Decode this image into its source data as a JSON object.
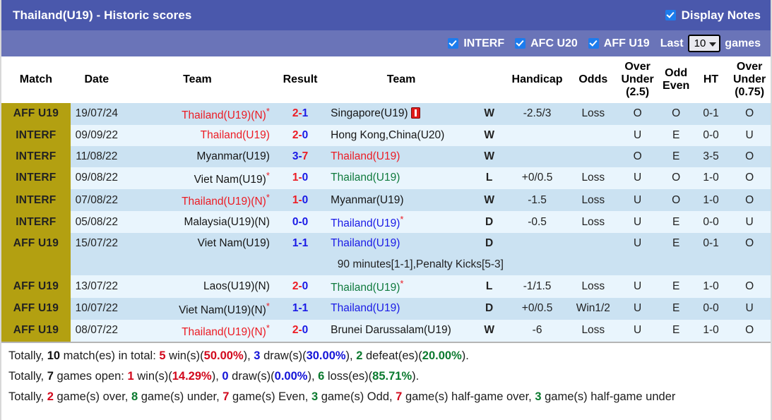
{
  "header": {
    "title": "Thailand(U19) - Historic scores",
    "display_notes_label": "Display Notes",
    "display_notes_checked": true
  },
  "filters": {
    "items": [
      {
        "label": "INTERF",
        "checked": true
      },
      {
        "label": "AFC U20",
        "checked": true
      },
      {
        "label": "AFF U19",
        "checked": true
      }
    ],
    "last_label": "Last",
    "games_count": "10",
    "games_label": "games"
  },
  "table": {
    "columns": [
      "Match",
      "Date",
      "Team",
      "Result",
      "Team",
      "",
      "Handicap",
      "Odds",
      "Over Under (2.5)",
      "Odd Even",
      "HT",
      "Over Under (0.75)"
    ],
    "columns_multiline": {
      "over_under_25": [
        "Over",
        "Under",
        "(2.5)"
      ],
      "odd_even": [
        "Odd",
        "Even"
      ],
      "over_under_075": [
        "Over",
        "Under",
        "(0.75)"
      ]
    },
    "rows": [
      {
        "league": "AFF U19",
        "date": "19/07/24",
        "home": "Thailand(U19)(N)",
        "home_color": "red",
        "home_star": true,
        "score_left": "2",
        "score_right": "1",
        "score_left_color": "red",
        "score_right_color": "blue",
        "away": "Singapore(U19)",
        "away_color": "black",
        "away_star": false,
        "away_redcard": true,
        "wld": "W",
        "wld_color": "red",
        "handicap": "-2.5/3",
        "odds": "Loss",
        "odds_color": "green",
        "ou": "O",
        "ou_color": "red",
        "oe": "O",
        "oe_color": "green",
        "ht": "0-1",
        "ou2": "O",
        "ou2_color": "red",
        "note": null
      },
      {
        "league": "INTERF",
        "date": "09/09/22",
        "home": "Thailand(U19)",
        "home_color": "red",
        "home_star": false,
        "score_left": "2",
        "score_right": "0",
        "score_left_color": "red",
        "score_right_color": "blue",
        "away": "Hong Kong,China(U20)",
        "away_color": "black",
        "away_star": false,
        "away_redcard": false,
        "wld": "W",
        "wld_color": "red",
        "handicap": "",
        "odds": "",
        "odds_color": "green",
        "ou": "U",
        "ou_color": "green",
        "oe": "E",
        "oe_color": "red",
        "ht": "0-0",
        "ou2": "U",
        "ou2_color": "green",
        "note": null
      },
      {
        "league": "INTERF",
        "date": "11/08/22",
        "home": "Myanmar(U19)",
        "home_color": "black",
        "home_star": false,
        "score_left": "3",
        "score_right": "7",
        "score_left_color": "blue",
        "score_right_color": "red",
        "away": "Thailand(U19)",
        "away_color": "red",
        "away_star": false,
        "away_redcard": false,
        "wld": "W",
        "wld_color": "red",
        "handicap": "",
        "odds": "",
        "odds_color": "green",
        "ou": "O",
        "ou_color": "red",
        "oe": "E",
        "oe_color": "red",
        "ht": "3-5",
        "ou2": "O",
        "ou2_color": "red",
        "note": null
      },
      {
        "league": "INTERF",
        "date": "09/08/22",
        "home": "Viet Nam(U19)",
        "home_color": "black",
        "home_star": true,
        "score_left": "1",
        "score_right": "0",
        "score_left_color": "red",
        "score_right_color": "blue",
        "away": "Thailand(U19)",
        "away_color": "green",
        "away_star": false,
        "away_redcard": false,
        "wld": "L",
        "wld_color": "green",
        "handicap": "+0/0.5",
        "odds": "Loss",
        "odds_color": "green",
        "ou": "U",
        "ou_color": "green",
        "oe": "O",
        "oe_color": "green",
        "ht": "1-0",
        "ou2": "O",
        "ou2_color": "red",
        "note": null
      },
      {
        "league": "INTERF",
        "date": "07/08/22",
        "home": "Thailand(U19)(N)",
        "home_color": "red",
        "home_star": true,
        "score_left": "1",
        "score_right": "0",
        "score_left_color": "red",
        "score_right_color": "blue",
        "away": "Myanmar(U19)",
        "away_color": "black",
        "away_star": false,
        "away_redcard": false,
        "wld": "W",
        "wld_color": "red",
        "handicap": "-1.5",
        "odds": "Loss",
        "odds_color": "green",
        "ou": "U",
        "ou_color": "green",
        "oe": "O",
        "oe_color": "green",
        "ht": "1-0",
        "ou2": "O",
        "ou2_color": "red",
        "note": null
      },
      {
        "league": "INTERF",
        "date": "05/08/22",
        "home": "Malaysia(U19)(N)",
        "home_color": "black",
        "home_star": false,
        "score_left": "0",
        "score_right": "0",
        "score_left_color": "blue",
        "score_right_color": "blue",
        "away": "Thailand(U19)",
        "away_color": "blue",
        "away_star": true,
        "away_redcard": false,
        "wld": "D",
        "wld_color": "blue",
        "handicap": "-0.5",
        "odds": "Loss",
        "odds_color": "green",
        "ou": "U",
        "ou_color": "green",
        "oe": "E",
        "oe_color": "red",
        "ht": "0-0",
        "ou2": "U",
        "ou2_color": "green",
        "note": null
      },
      {
        "league": "AFF U19",
        "date": "15/07/22",
        "home": "Viet Nam(U19)",
        "home_color": "black",
        "home_star": false,
        "score_left": "1",
        "score_right": "1",
        "score_left_color": "blue",
        "score_right_color": "blue",
        "away": "Thailand(U19)",
        "away_color": "blue",
        "away_star": false,
        "away_redcard": false,
        "wld": "D",
        "wld_color": "blue",
        "handicap": "",
        "odds": "",
        "odds_color": "green",
        "ou": "U",
        "ou_color": "green",
        "oe": "E",
        "oe_color": "red",
        "ht": "0-1",
        "ou2": "O",
        "ou2_color": "red",
        "note": "90 minutes[1-1],Penalty Kicks[5-3]"
      },
      {
        "league": "AFF U19",
        "date": "13/07/22",
        "home": "Laos(U19)(N)",
        "home_color": "black",
        "home_star": false,
        "score_left": "2",
        "score_right": "0",
        "score_left_color": "red",
        "score_right_color": "blue",
        "away": "Thailand(U19)",
        "away_color": "green",
        "away_star": true,
        "away_redcard": false,
        "wld": "L",
        "wld_color": "green",
        "handicap": "-1/1.5",
        "odds": "Loss",
        "odds_color": "green",
        "ou": "U",
        "ou_color": "green",
        "oe": "E",
        "oe_color": "red",
        "ht": "1-0",
        "ou2": "O",
        "ou2_color": "red",
        "note": null
      },
      {
        "league": "AFF U19",
        "date": "10/07/22",
        "home": "Viet Nam(U19)(N)",
        "home_color": "black",
        "home_star": true,
        "score_left": "1",
        "score_right": "1",
        "score_left_color": "blue",
        "score_right_color": "blue",
        "away": "Thailand(U19)",
        "away_color": "blue",
        "away_star": false,
        "away_redcard": false,
        "wld": "D",
        "wld_color": "blue",
        "handicap": "+0/0.5",
        "odds": "Win1/2",
        "odds_color": "red",
        "ou": "U",
        "ou_color": "green",
        "oe": "E",
        "oe_color": "red",
        "ht": "0-0",
        "ou2": "U",
        "ou2_color": "green",
        "note": null
      },
      {
        "league": "AFF U19",
        "date": "08/07/22",
        "home": "Thailand(U19)(N)",
        "home_color": "red",
        "home_star": true,
        "score_left": "2",
        "score_right": "0",
        "score_left_color": "red",
        "score_right_color": "blue",
        "away": "Brunei Darussalam(U19)",
        "away_color": "black",
        "away_star": false,
        "away_redcard": false,
        "wld": "W",
        "wld_color": "red",
        "handicap": "-6",
        "odds": "Loss",
        "odds_color": "green",
        "ou": "U",
        "ou_color": "green",
        "oe": "E",
        "oe_color": "red",
        "ht": "1-0",
        "ou2": "O",
        "ou2_color": "red",
        "note": null
      }
    ]
  },
  "summary": {
    "line1": {
      "prefix": "Totally, ",
      "total": "10",
      "mid1": " match(es) in total: ",
      "wins": "5",
      "wins_label": " win(s)(",
      "wins_pct": "50.00%",
      "close1": "), ",
      "draws": "3",
      "draws_label": " draw(s)(",
      "draws_pct": "30.00%",
      "close2": "), ",
      "defeats": "2",
      "defeats_label": " defeat(es)(",
      "defeats_pct": "20.00%",
      "close3": ")."
    },
    "line2": {
      "prefix": "Totally, ",
      "open": "7",
      "mid1": " games open: ",
      "wins": "1",
      "wins_label": " win(s)(",
      "wins_pct": "14.29%",
      "close1": "), ",
      "draws": "0",
      "draws_label": " draw(s)(",
      "draws_pct": "0.00%",
      "close2": "), ",
      "losses": "6",
      "losses_label": " loss(es)(",
      "losses_pct": "85.71%",
      "close3": ")."
    },
    "line3": {
      "prefix": "Totally, ",
      "over": "2",
      "over_label": " game(s) over, ",
      "under": "8",
      "under_label": " game(s) under, ",
      "even": "7",
      "even_label": " game(s) Even, ",
      "odd": "3",
      "odd_label": " game(s) Odd, ",
      "half_over": "7",
      "half_over_label": " game(s) half-game over, ",
      "half_under": "3",
      "half_under_label": " game(s) half-game under"
    }
  },
  "colors": {
    "title_bar": "#4a58ac",
    "filter_bar": "#6a74b8",
    "league_badge": "#b3a011",
    "row_odd": "#cbe2f2",
    "row_even": "#e9f5fd",
    "red": "#ec1c24",
    "blue": "#1a1ae6",
    "green": "#0f7a3d"
  }
}
